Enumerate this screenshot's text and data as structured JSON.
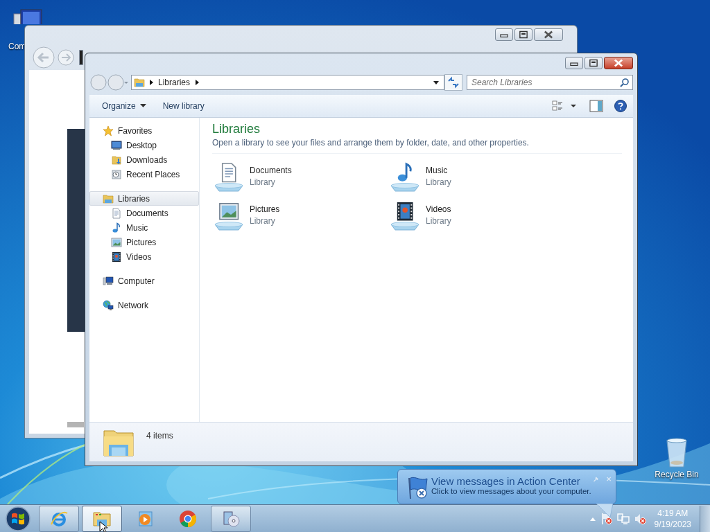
{
  "desktop_icons": [
    {
      "label": "Com",
      "kind": "computer"
    },
    {
      "label": "Recycle Bin",
      "kind": "recycle"
    }
  ],
  "window": {
    "address": {
      "crumbs": [
        "Libraries"
      ]
    },
    "search": {
      "placeholder": "Search Libraries"
    },
    "toolbar": [
      {
        "label": "Organize",
        "kind": "menu"
      },
      {
        "label": "New library",
        "kind": "plain"
      }
    ],
    "nav_pane": [
      {
        "label": "Favorites",
        "kind": "star",
        "selected": false,
        "children": [
          {
            "label": "Desktop",
            "kind": "desktop",
            "selected": false
          },
          {
            "label": "Downloads",
            "kind": "downloads",
            "selected": false
          },
          {
            "label": "Recent Places",
            "kind": "recent",
            "selected": false
          }
        ]
      },
      {
        "label": "Libraries",
        "kind": "libraries",
        "selected": true,
        "children": [
          {
            "label": "Documents",
            "kind": "documents",
            "selected": false
          },
          {
            "label": "Music",
            "kind": "music",
            "selected": false
          },
          {
            "label": "Pictures",
            "kind": "pictures",
            "selected": false
          },
          {
            "label": "Videos",
            "kind": "videos",
            "selected": false
          }
        ]
      },
      {
        "label": "Computer",
        "kind": "computer",
        "selected": false
      },
      {
        "label": "Network",
        "kind": "network",
        "selected": false
      }
    ],
    "heading": "Libraries",
    "description": "Open a library to see your files and arrange them by folder, date, and other properties.",
    "items": [
      {
        "name": "Documents",
        "type": "Library",
        "kind": "documents"
      },
      {
        "name": "Music",
        "type": "Library",
        "kind": "music"
      },
      {
        "name": "Pictures",
        "type": "Library",
        "kind": "pictures"
      },
      {
        "name": "Videos",
        "type": "Library",
        "kind": "videos"
      }
    ],
    "status": "4 items"
  },
  "notification": {
    "title": "View messages in Action Center",
    "text": "Click to view messages about your computer."
  },
  "taskbar": {
    "buttons": [
      {
        "kind": "ie",
        "running": true,
        "selected": false
      },
      {
        "kind": "explorer",
        "running": true,
        "selected": true
      },
      {
        "kind": "media",
        "running": false,
        "selected": false
      },
      {
        "kind": "chrome",
        "running": false,
        "selected": false
      },
      {
        "kind": "disc",
        "running": true,
        "selected": false
      }
    ],
    "time": "4:19 AM",
    "date": "9/19/2023"
  }
}
